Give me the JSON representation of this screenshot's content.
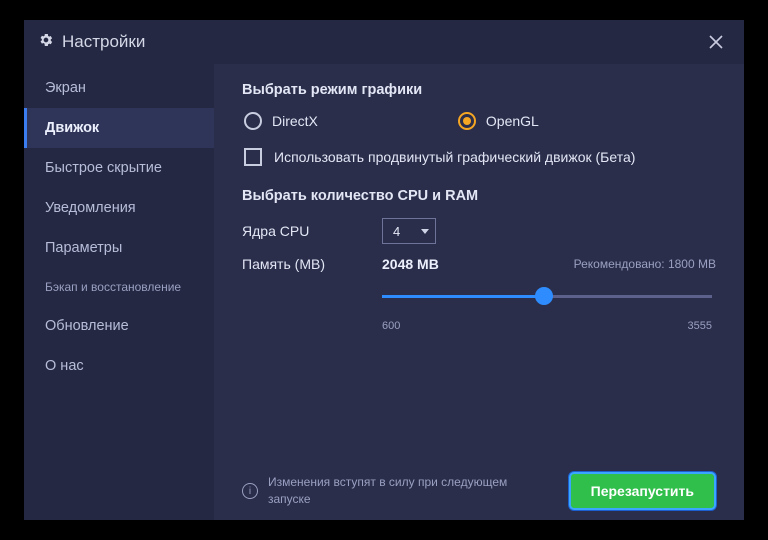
{
  "title": "Настройки",
  "sidebar": {
    "items": [
      {
        "label": "Экран",
        "active": false
      },
      {
        "label": "Движок",
        "active": true
      },
      {
        "label": "Быстрое скрытие",
        "active": false
      },
      {
        "label": "Уведомления",
        "active": false
      },
      {
        "label": "Параметры",
        "active": false
      },
      {
        "label": "Бэкап и восстановление",
        "active": false,
        "small": true
      },
      {
        "label": "Обновление",
        "active": false
      },
      {
        "label": "О нас",
        "active": false
      }
    ]
  },
  "graphics": {
    "section_label": "Выбрать режим графики",
    "options": [
      {
        "label": "DirectX",
        "checked": false
      },
      {
        "label": "OpenGL",
        "checked": true
      }
    ],
    "advanced_checkbox_label": "Использовать продвинутый графический движок (Бета)",
    "advanced_checked": false
  },
  "cpu_ram": {
    "section_label": "Выбрать количество CPU и RAM",
    "cpu_label": "Ядра CPU",
    "cpu_value": "4",
    "mem_label": "Память (MB)",
    "mem_value": "2048 MB",
    "recommended": "Рекомендовано: 1800 MB",
    "slider": {
      "min": 600,
      "max": 3555,
      "value": 2048,
      "min_label": "600",
      "max_label": "3555"
    }
  },
  "footer": {
    "info_text": "Изменения вступят в силу при следующем запуске",
    "restart_label": "Перезапустить"
  }
}
